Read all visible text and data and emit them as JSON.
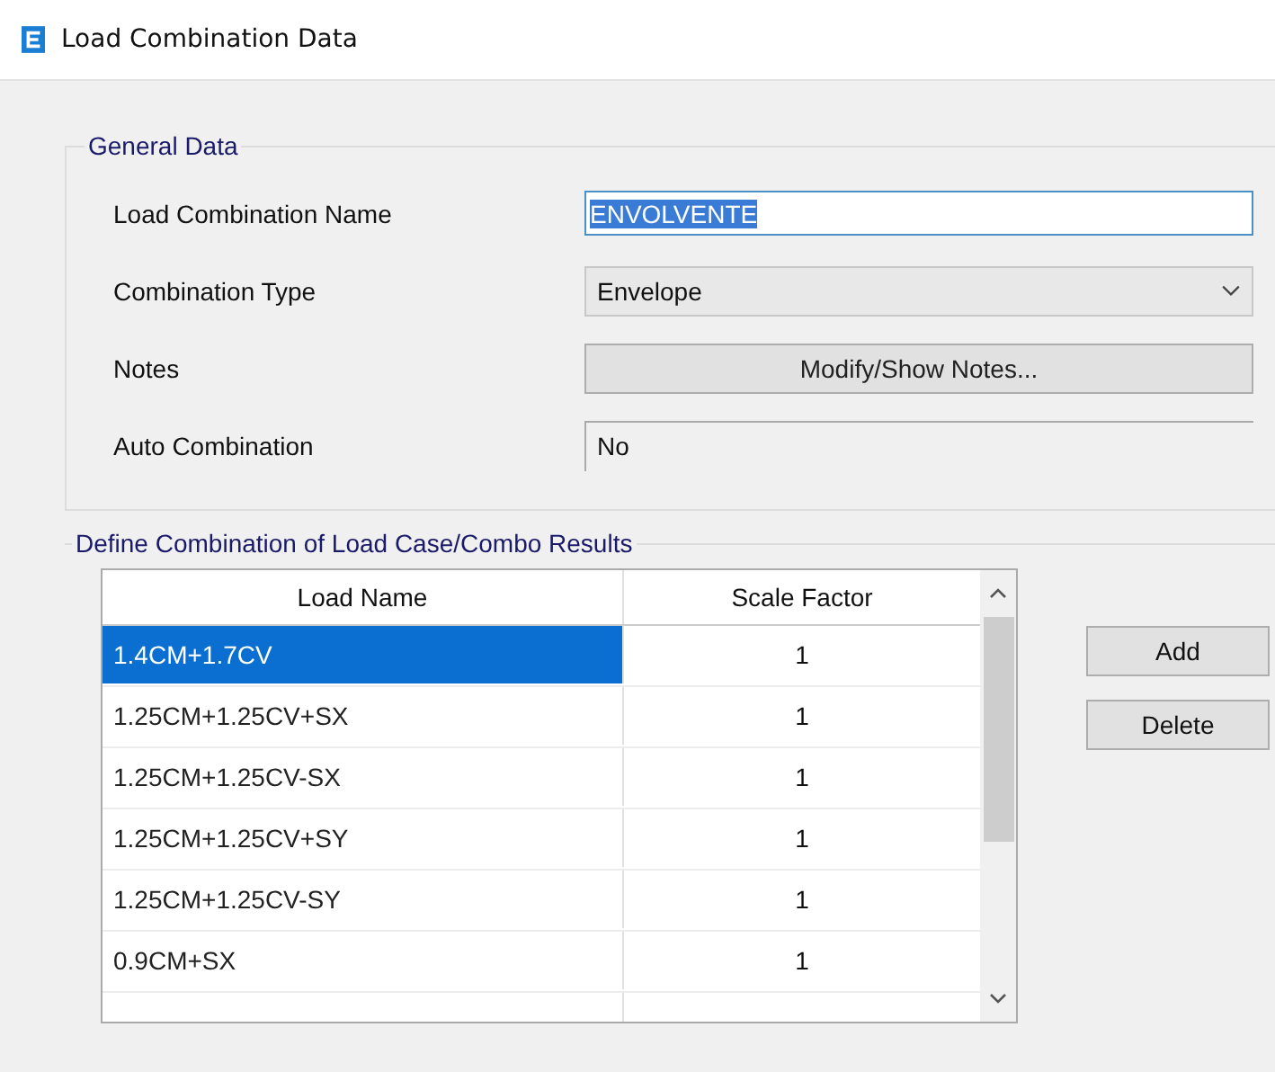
{
  "window": {
    "title": "Load Combination Data"
  },
  "general_data": {
    "title": "General Data",
    "fields": [
      {
        "kind": "text",
        "label": "Load Combination Name",
        "value": "ENVOLVENTE"
      },
      {
        "kind": "dropdown",
        "label": "Combination Type",
        "value": "Envelope"
      },
      {
        "kind": "button",
        "label": "Notes",
        "value": "Modify/Show Notes..."
      },
      {
        "kind": "readonly",
        "label": "Auto Combination",
        "value": "No"
      }
    ]
  },
  "combination": {
    "title": "Define Combination of Load Case/Combo Results",
    "table": {
      "columns": [
        "Load Name",
        "Scale Factor"
      ],
      "rows": [
        {
          "load_name": "1.4CM+1.7CV",
          "scale_factor": "1",
          "selected": true
        },
        {
          "load_name": "1.25CM+1.25CV+SX",
          "scale_factor": "1",
          "selected": false
        },
        {
          "load_name": "1.25CM+1.25CV-SX",
          "scale_factor": "1",
          "selected": false
        },
        {
          "load_name": "1.25CM+1.25CV+SY",
          "scale_factor": "1",
          "selected": false
        },
        {
          "load_name": "1.25CM+1.25CV-SY",
          "scale_factor": "1",
          "selected": false
        },
        {
          "load_name": "0.9CM+SX",
          "scale_factor": "1",
          "selected": false
        }
      ]
    },
    "buttons": [
      "Add",
      "Delete"
    ]
  }
}
